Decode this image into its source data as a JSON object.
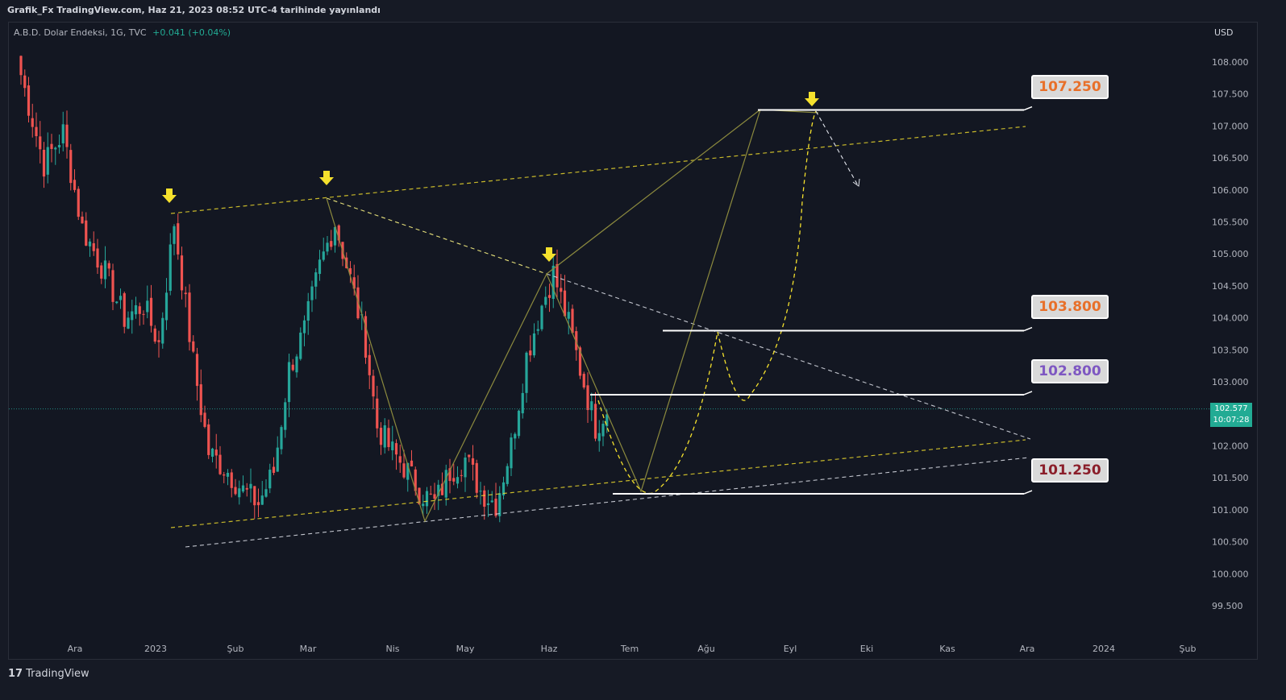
{
  "header": {
    "publisher": "Grafik_Fx TradingView.com, Haz 21, 2023 08:52 UTC-4 tarihinde yayınlandı"
  },
  "symbol": {
    "name": "A.B.D. Dolar Endeksi, 1G, TVC",
    "change": "+0.041 (+0.04%)"
  },
  "footer": {
    "brand": "TradingView",
    "logo_glyph": "17"
  },
  "price_axis": {
    "currency": "USD"
  },
  "current_price": {
    "value": "102.577",
    "countdown": "10:07:28"
  },
  "callouts": [
    {
      "label": "107.250",
      "color": "#e8702a"
    },
    {
      "label": "103.800",
      "color": "#e8702a"
    },
    {
      "label": "102.800",
      "color": "#7e57c2"
    },
    {
      "label": "101.250",
      "color": "#8b1e2a"
    }
  ],
  "colors": {
    "up": "#26a69a",
    "down": "#ef5350",
    "yellow": "#f5e12d",
    "olive": "#8c8a3e"
  },
  "chart_data": {
    "type": "candlestick",
    "y_ticks": [
      "108.000",
      "107.500",
      "107.000",
      "106.500",
      "106.000",
      "105.500",
      "105.000",
      "104.500",
      "104.000",
      "103.500",
      "103.000",
      "102.500",
      "102.000",
      "101.500",
      "101.000",
      "100.500",
      "100.000",
      "99.500"
    ],
    "x_ticks": [
      "Ara",
      "2023",
      "Şub",
      "Mar",
      "Nis",
      "May",
      "Haz",
      "Tem",
      "Ağu",
      "Eyl",
      "Eki",
      "Kas",
      "Ara",
      "2024",
      "Şub"
    ],
    "ylim": [
      99.0,
      108.5
    ],
    "grid": false,
    "levels": [
      107.25,
      103.8,
      102.8,
      101.25
    ],
    "current": 102.577,
    "anchors": [
      {
        "i": 0,
        "v": 107.8
      },
      {
        "i": 6,
        "v": 106.4
      },
      {
        "i": 11,
        "v": 106.9
      },
      {
        "i": 16,
        "v": 105.4
      },
      {
        "i": 22,
        "v": 104.7
      },
      {
        "i": 27,
        "v": 104.0
      },
      {
        "i": 32,
        "v": 104.2
      },
      {
        "i": 36,
        "v": 103.6
      },
      {
        "i": 40,
        "v": 105.5
      },
      {
        "i": 45,
        "v": 103.3
      },
      {
        "i": 49,
        "v": 101.9
      },
      {
        "i": 54,
        "v": 101.6
      },
      {
        "i": 58,
        "v": 101.3
      },
      {
        "i": 62,
        "v": 101.1
      },
      {
        "i": 66,
        "v": 101.6
      },
      {
        "i": 70,
        "v": 103.2
      },
      {
        "i": 74,
        "v": 103.8
      },
      {
        "i": 78,
        "v": 104.8
      },
      {
        "i": 82,
        "v": 105.5
      },
      {
        "i": 86,
        "v": 104.6
      },
      {
        "i": 90,
        "v": 103.6
      },
      {
        "i": 93,
        "v": 102.3
      },
      {
        "i": 97,
        "v": 101.9
      },
      {
        "i": 101,
        "v": 101.6
      },
      {
        "i": 104,
        "v": 101.3
      },
      {
        "i": 108,
        "v": 101.1
      },
      {
        "i": 112,
        "v": 101.6
      },
      {
        "i": 116,
        "v": 101.8
      },
      {
        "i": 120,
        "v": 101.3
      },
      {
        "i": 124,
        "v": 101.1
      },
      {
        "i": 128,
        "v": 102.0
      },
      {
        "i": 132,
        "v": 103.4
      },
      {
        "i": 136,
        "v": 104.2
      },
      {
        "i": 139,
        "v": 104.7
      },
      {
        "i": 143,
        "v": 103.9
      },
      {
        "i": 146,
        "v": 103.2
      },
      {
        "i": 150,
        "v": 102.3
      },
      {
        "i": 153,
        "v": 102.58
      }
    ],
    "candle_count": 154
  }
}
